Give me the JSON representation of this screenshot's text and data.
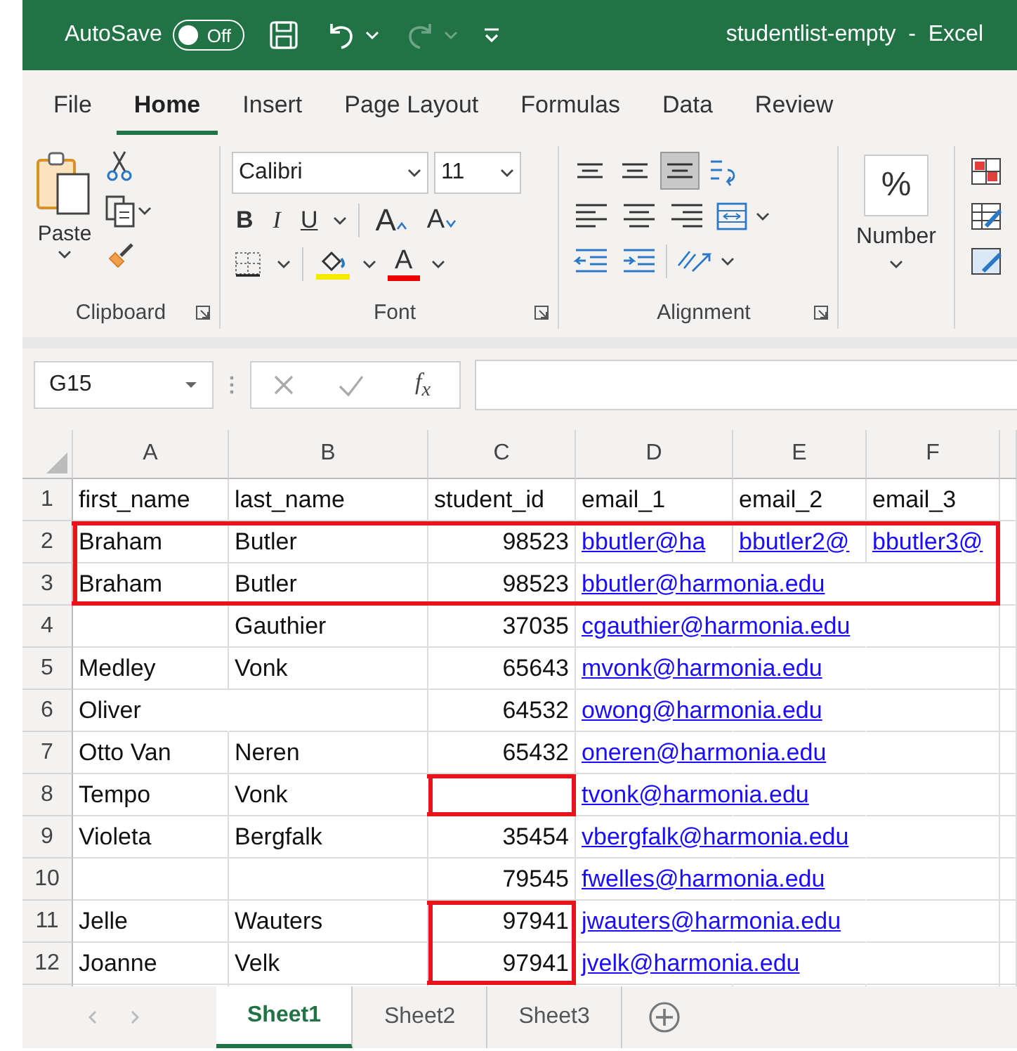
{
  "title_bar": {
    "autosave_label": "AutoSave",
    "autosave_toggle": {
      "label": "Off",
      "on": false
    },
    "redo": {
      "disabled": true
    },
    "title": "studentlist-empty  -  Excel"
  },
  "tabs": [
    {
      "label": "File",
      "selected": false
    },
    {
      "label": "Home",
      "selected": true
    },
    {
      "label": "Insert",
      "selected": false
    },
    {
      "label": "Page Layout",
      "selected": false
    },
    {
      "label": "Formulas",
      "selected": false
    },
    {
      "label": "Data",
      "selected": false
    },
    {
      "label": "Review",
      "selected": false
    }
  ],
  "ribbon": {
    "clipboard": {
      "paste_label": "Paste",
      "group_label": "Clipboard"
    },
    "font": {
      "font_name": "Calibri",
      "font_size": "11",
      "bold": "B",
      "italic": "I",
      "underline": "U",
      "grow": "A",
      "shrink": "A",
      "font_color": "A",
      "group_label": "Font"
    },
    "alignment": {
      "vertical": [
        {
          "selected": false
        },
        {
          "selected": false
        },
        {
          "selected": true
        }
      ],
      "group_label": "Alignment"
    },
    "number": {
      "percent": "%",
      "format": "Number"
    }
  },
  "formula_bar": {
    "name_box": "G15",
    "function_label": "f$_{x}$"
  },
  "grid": {
    "columns": [
      "A",
      "B",
      "C",
      "D",
      "E",
      "F"
    ],
    "rows": [
      {
        "header": "1",
        "cells": [
          {
            "kind": "text",
            "text": "first_name"
          },
          {
            "kind": "text",
            "text": "last_name"
          },
          {
            "kind": "text",
            "text": "student_id"
          },
          {
            "kind": "text",
            "text": "email_1"
          },
          {
            "kind": "text",
            "text": "email_2"
          },
          {
            "kind": "text",
            "text": "email_3"
          }
        ]
      },
      {
        "header": "2",
        "cells": [
          {
            "kind": "text",
            "text": "Braham",
            "box": {
              "top": true,
              "left": true
            }
          },
          {
            "kind": "text",
            "text": "Butler",
            "box": {
              "top": true
            }
          },
          {
            "kind": "number",
            "text": "98523",
            "box": {
              "top": true
            }
          },
          {
            "kind": "link",
            "text": "bbutler@ha",
            "box": {
              "top": true
            }
          },
          {
            "kind": "link",
            "text": "bbutler2@",
            "box": {
              "top": true
            }
          },
          {
            "kind": "link",
            "text": "bbutler3@",
            "box": {
              "top": true,
              "right": true
            }
          }
        ]
      },
      {
        "header": "3",
        "cells": [
          {
            "kind": "text",
            "text": "Braham",
            "box": {
              "bottom": true,
              "left": true
            }
          },
          {
            "kind": "text",
            "text": "Butler",
            "box": {
              "bottom": true
            }
          },
          {
            "kind": "number",
            "text": "98523",
            "box": {
              "bottom": true
            }
          },
          {
            "kind": "link",
            "text": "bbutler@harmonia.edu",
            "box": {
              "bottom": true
            }
          },
          {
            "kind": "link",
            "box": {
              "bottom": true
            }
          },
          {
            "kind": "link",
            "box": {
              "bottom": true,
              "right": true
            }
          }
        ]
      },
      {
        "header": "4",
        "cells": [
          {
            "kind": "text"
          },
          {
            "kind": "text",
            "text": "Gauthier"
          },
          {
            "kind": "number",
            "text": "37035"
          },
          {
            "kind": "link",
            "text": "cgauthier@harmonia.edu"
          },
          {
            "kind": "link"
          },
          {
            "kind": "link"
          }
        ]
      },
      {
        "header": "5",
        "cells": [
          {
            "kind": "text",
            "text": "Medley"
          },
          {
            "kind": "text",
            "text": "Vonk"
          },
          {
            "kind": "number",
            "text": "65643"
          },
          {
            "kind": "link",
            "text": "mvonk@harmonia.edu"
          },
          {
            "kind": "link"
          },
          {
            "kind": "link"
          }
        ]
      },
      {
        "header": "6",
        "cells": [
          {
            "kind": "text",
            "text": "Oliver"
          },
          {
            "kind": "text"
          },
          {
            "kind": "number",
            "text": "64532"
          },
          {
            "kind": "link",
            "text": "owong@harmonia.edu"
          },
          {
            "kind": "link"
          },
          {
            "kind": "link"
          }
        ]
      },
      {
        "header": "7",
        "cells": [
          {
            "kind": "text",
            "text": "Otto Van"
          },
          {
            "kind": "text",
            "text": "Neren"
          },
          {
            "kind": "number",
            "text": "65432"
          },
          {
            "kind": "link",
            "text": "oneren@harmonia.edu"
          },
          {
            "kind": "link"
          },
          {
            "kind": "link"
          }
        ]
      },
      {
        "header": "8",
        "cells": [
          {
            "kind": "text",
            "text": "Tempo"
          },
          {
            "kind": "text",
            "text": "Vonk"
          },
          {
            "kind": "number",
            "box": {
              "top": true,
              "bottom": true,
              "left": true,
              "right": true
            }
          },
          {
            "kind": "link",
            "text": "tvonk@harmonia.edu"
          },
          {
            "kind": "link"
          },
          {
            "kind": "link"
          }
        ]
      },
      {
        "header": "9",
        "cells": [
          {
            "kind": "text",
            "text": "Violeta"
          },
          {
            "kind": "text",
            "text": "Bergfalk"
          },
          {
            "kind": "number",
            "text": "35454"
          },
          {
            "kind": "link",
            "text": "vbergfalk@harmonia.edu"
          },
          {
            "kind": "link"
          },
          {
            "kind": "link"
          }
        ]
      },
      {
        "header": "10",
        "cells": [
          {
            "kind": "text"
          },
          {
            "kind": "text"
          },
          {
            "kind": "number",
            "text": "79545"
          },
          {
            "kind": "link",
            "text": "fwelles@harmonia.edu"
          },
          {
            "kind": "link"
          },
          {
            "kind": "link"
          }
        ]
      },
      {
        "header": "11",
        "cells": [
          {
            "kind": "text",
            "text": "Jelle"
          },
          {
            "kind": "text",
            "text": "Wauters"
          },
          {
            "kind": "number",
            "text": "97941",
            "box": {
              "top": true,
              "left": true,
              "right": true
            }
          },
          {
            "kind": "link",
            "text": "jwauters@harmonia.edu"
          },
          {
            "kind": "link"
          },
          {
            "kind": "link"
          }
        ]
      },
      {
        "header": "12",
        "cells": [
          {
            "kind": "text",
            "text": "Joanne"
          },
          {
            "kind": "text",
            "text": "Velk"
          },
          {
            "kind": "number",
            "text": "97941",
            "box": {
              "bottom": true,
              "left": true,
              "right": true
            }
          },
          {
            "kind": "link",
            "text": "jvelk@harmonia.edu"
          },
          {
            "kind": "link"
          },
          {
            "kind": "link"
          }
        ]
      }
    ]
  },
  "sheet_tabs": [
    {
      "label": "Sheet1",
      "selected": true
    },
    {
      "label": "Sheet2",
      "selected": false
    },
    {
      "label": "Sheet3",
      "selected": false
    }
  ]
}
